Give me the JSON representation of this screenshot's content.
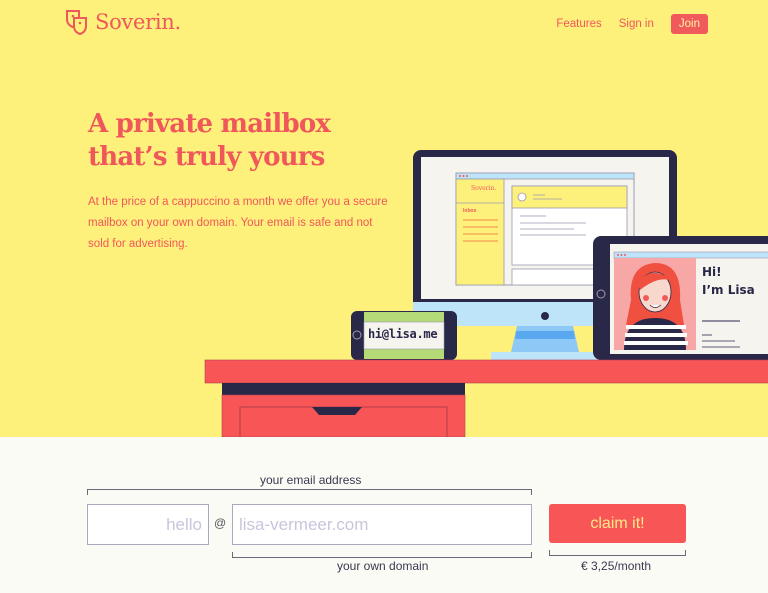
{
  "brand": {
    "name": "Soverin.",
    "icon": "shield-logo-icon",
    "color": "#f0575b"
  },
  "nav": {
    "features": "Features",
    "sign_in": "Sign in",
    "join": "Join"
  },
  "hero": {
    "headline_line1": "A private mailbox",
    "headline_line2": "that’s truly yours",
    "subtext": "At the price of a cappuccino a month we offer you a secure mailbox on your own domain. Your email is safe and not sold for advertising.",
    "background": "#fef17b"
  },
  "illustration": {
    "monitor_app_brand": "Soverin.",
    "monitor_sidebar_item": "Inbox",
    "phone_text": "hi@lisa.me",
    "tablet_greeting_line1": "Hi!",
    "tablet_greeting_line2": "I’m Lisa"
  },
  "signup": {
    "email_label": "your email address",
    "local_placeholder": "hello",
    "at_symbol": "@",
    "domain_placeholder": "lisa-vermeer.com",
    "domain_label": "your own domain",
    "claim_button": "claim it!",
    "price": "€ 3,25/month",
    "accent": "#f85656"
  }
}
